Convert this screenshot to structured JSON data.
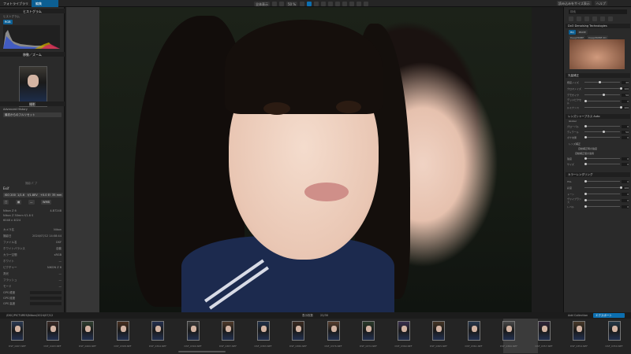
{
  "topbar": {
    "tab_library": "フォトライブラリ",
    "tab_edit": "編集",
    "zoom_label": "全体表示",
    "zoom_value": "50 %",
    "right_btn1": "読み込みをサイズ表示",
    "right_btn2": "ヘルプ"
  },
  "left": {
    "histogram_title": "ヒストグラム",
    "histogram_sub": "ヒストグラム",
    "histogram_chip": "RGB",
    "nav_title": "移動／ズーム",
    "nav_sub": "撮影",
    "advanced_title": "Advanced History",
    "advanced_btn": "最初からのフルリセット",
    "history_link": "撮影パ ブ",
    "exif_title": "Exif",
    "exif_btns": [
      "ISO 200",
      "1/1.6",
      "f/1.8EV",
      "+0.0 EV",
      "35 mm"
    ],
    "exif_row2": [
      "□",
      "▦",
      "—",
      "WMB"
    ],
    "camera": "Nikon Z 6",
    "camera_num": "4-B7248",
    "lens": "Nikon Z 50mm f/1.8 S",
    "dims": "6048 x 4024",
    "meta_rows": [
      {
        "k": "カメラ名",
        "v": "Nikon"
      },
      {
        "k": "撮影日",
        "v": "2024/07/12 14:08:44"
      },
      {
        "k": "ファイル名",
        "v": "DSF"
      },
      {
        "k": "ホワイトバランス",
        "v": "自動"
      },
      {
        "k": "カラー空間",
        "v": "sRGB"
      },
      {
        "k": "ホワイト",
        "v": "—"
      },
      {
        "k": "ピクチャー",
        "v": "NIKON Z 6"
      },
      {
        "k": "測光",
        "v": "—"
      },
      {
        "k": "フラッシュ",
        "v": "—"
      },
      {
        "k": "モード",
        "v": "—"
      }
    ],
    "gps_rows": [
      "GPS 緯度",
      "GPS 経度",
      "GPS 高度"
    ]
  },
  "right": {
    "search_placeholder": "検索",
    "optics_title": "DxO Denoising Technologies",
    "optics_val": "DeepPRIME",
    "denoise_modes": [
      "HQ",
      "PRIME",
      "DeepPRIME",
      "DeepPRIME XD"
    ],
    "section_tone": "光量補正",
    "sliders_tone": [
      {
        "label": "輝度ノイズ",
        "v": "40"
      },
      {
        "label": "クロマノイズ",
        "v": "100"
      },
      {
        "label": "デモザイク",
        "v": "50"
      },
      {
        "label": "デッドピクセル",
        "v": "0"
      },
      {
        "label": "ルミナンス",
        "v": "100"
      }
    ],
    "section_lens": "レンズシャープネス",
    "section_lens_val": "Auto",
    "lens_mode": "Global",
    "sliders_lens": [
      {
        "label": "グローバル",
        "v": "0"
      },
      {
        "label": "ディテール",
        "v": "50"
      },
      {
        "label": "ボケ効果",
        "v": "0"
      }
    ],
    "check_lens": "レンズ補正",
    "lens_sub": "自動補正時の強度",
    "sub_head": "自動補正値の適用",
    "sliders_extra": [
      {
        "label": "強度",
        "v": "0"
      },
      {
        "label": "サイズ",
        "v": "0"
      }
    ],
    "section_color": "カラーレンダリング",
    "sliders_color": [
      {
        "label": "HSL",
        "v": "0"
      },
      {
        "label": "彩度",
        "v": "100"
      },
      {
        "label": "トーン",
        "v": "0"
      },
      {
        "label": "ヴァイブランス",
        "v": "0"
      },
      {
        "label": "レベル",
        "v": "0"
      }
    ]
  },
  "film": {
    "path": "/DSC/PICTURES/Nikon/2024/07/12",
    "count_label": "表示枚数",
    "count_value": "22/30",
    "export_label": "エクスポート",
    "btn_collection": "Add Collection",
    "thumbs": [
      "DSF_0407.NEF",
      "DSF_0403.NEF",
      "DSF_0400.NEF",
      "DSF_0398.NEF",
      "DSF_0394.NEF",
      "DSF_0390.NEF",
      "DSF_0387.NEF",
      "DSF_0383.NEF",
      "DSF_0380.NEF",
      "DSF_0376.NEF",
      "DSF_0372.NEF",
      "DSF_0369.NEF",
      "DSF_0365.NEF",
      "DSF_0361.NEF",
      "DSF_0360.NEF",
      "DSF_0357.NEF",
      "DSF_0354.NEF",
      "DSF_0350.NEF"
    ]
  }
}
